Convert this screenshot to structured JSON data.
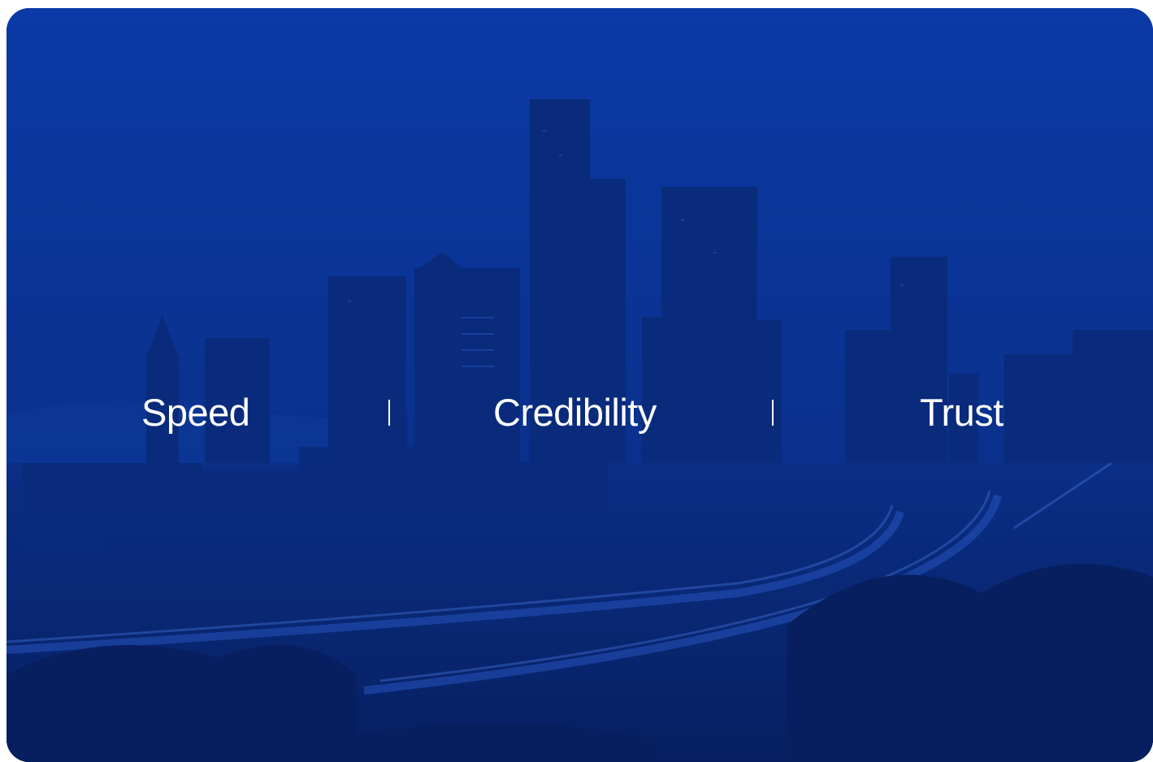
{
  "hero": {
    "background_description_color": "#0a2e86",
    "pillars": [
      {
        "label": "Speed"
      },
      {
        "label": "Credibility"
      },
      {
        "label": "Trust"
      }
    ]
  }
}
